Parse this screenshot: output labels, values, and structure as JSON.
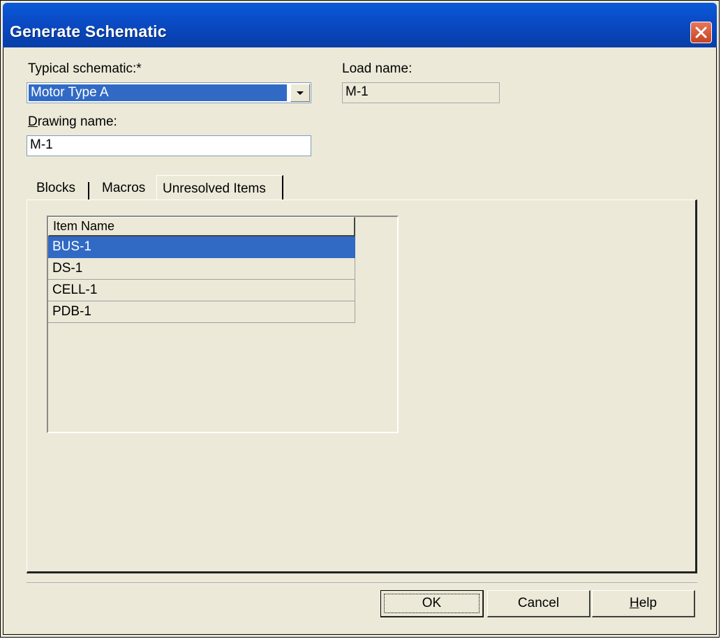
{
  "window": {
    "title": "Generate Schematic"
  },
  "form": {
    "typical_label": "Typical schematic:*",
    "typical_value": "Motor Type A",
    "load_label": "Load name:",
    "load_value": "M-1",
    "drawing_label_prefix": "D",
    "drawing_label_rest": "rawing name:",
    "drawing_value": "M-1"
  },
  "tabs": [
    {
      "label": "Blocks",
      "active": false
    },
    {
      "label": "Macros",
      "active": false
    },
    {
      "label": "Unresolved Items",
      "active": true
    }
  ],
  "list": {
    "header": "Item Name",
    "rows": [
      "BUS-1",
      "DS-1",
      "CELL-1",
      "PDB-1"
    ],
    "selected_index": 0
  },
  "buttons": {
    "ok": "OK",
    "cancel": "Cancel",
    "help_prefix": "H",
    "help_rest": "elp"
  },
  "colors": {
    "titlebar": "#0a4bc6",
    "selection": "#316ac5",
    "face": "#ece9d8",
    "close": "#c8421f"
  },
  "icons": {
    "close": "close-icon",
    "dropdown": "chevron-down-icon"
  }
}
